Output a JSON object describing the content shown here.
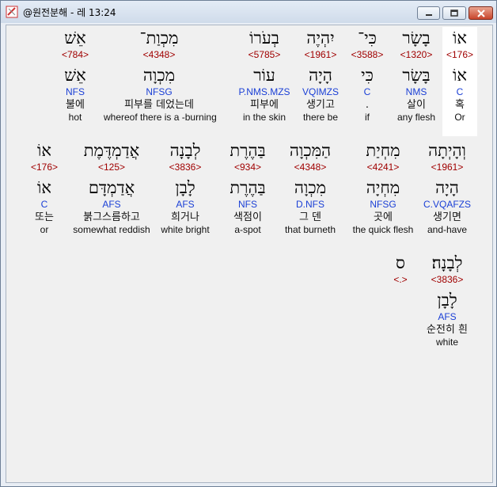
{
  "window": {
    "title": "@원전분해 - 레 13:24",
    "buttons": {
      "minimize": "minimize",
      "maximize": "maximize",
      "close": "close"
    }
  },
  "rows": [
    {
      "words": [
        {
          "heb": "אוֹ",
          "num": "<176>",
          "lemma": "אוֹ",
          "code": "C",
          "kor": "혹",
          "eng": "Or",
          "selected": true
        },
        {
          "heb": "בָשָׂר",
          "num": "<1320>",
          "lemma": "בָּשָׂר",
          "code": "NMS",
          "kor": "살이",
          "eng": "any flesh"
        },
        {
          "heb": "כִּי־",
          "num": "<3588>",
          "lemma": "כִּי",
          "code": "C",
          "kor": ".",
          "eng": "if"
        },
        {
          "heb": "יִהְיֶה",
          "num": "<1961>",
          "lemma": "הָיָה",
          "code": "VQIMZS",
          "kor": "생기고",
          "eng": "there be"
        },
        {
          "heb": "בְעֹרוֹ",
          "num": "<5785>",
          "lemma": "עוֹר",
          "code": "P.NMS.MZS",
          "kor": "피부에",
          "eng": "in the skin"
        },
        {
          "heb": "מִכְוַת־",
          "num": "<4348>",
          "lemma": "מִכְוָה",
          "code": "NFSG",
          "kor": "피부를 데었는데",
          "eng": "whereof there is a -burning"
        },
        {
          "heb": "אֵשׁ",
          "num": "<784>",
          "lemma": "אֵשׁ",
          "code": "NFS",
          "kor": "불에",
          "eng": "hot"
        }
      ]
    },
    {
      "words": [
        {
          "heb": "וְהָיְתָה",
          "num": "<1961>",
          "lemma": "הָיָה",
          "code": "C.VQAFZS",
          "kor": "생기면",
          "eng": "and-have"
        },
        {
          "heb": "מִחְיַת",
          "num": "<4241>",
          "lemma": "מִחְיָה",
          "code": "NFSG",
          "kor": "곳에",
          "eng": "the quick flesh"
        },
        {
          "heb": "הַמִּכְוָה",
          "num": "<4348>",
          "lemma": "מִכְוָה",
          "code": "D.NFS",
          "kor": "그 덴",
          "eng": "that burneth"
        },
        {
          "heb": "בַּהֶרֶת",
          "num": "<934>",
          "lemma": "בַּהֶרֶת",
          "code": "NFS",
          "kor": "색점이",
          "eng": "a-spot"
        },
        {
          "heb": "לְבָנָה",
          "num": "<3836>",
          "lemma": "לָבָן",
          "code": "AFS",
          "kor": "희거나",
          "eng": "white bright"
        },
        {
          "heb": "אֲדַמְדֶּמֶת",
          "num": "<125>",
          "lemma": "אֲדַמְדָּם",
          "code": "AFS",
          "kor": "붉그스름하고",
          "eng": "somewhat reddish"
        },
        {
          "heb": "אוֹ",
          "num": "<176>",
          "lemma": "אוֹ",
          "code": "C",
          "kor": "또는",
          "eng": "or"
        }
      ]
    },
    {
      "words": [
        {
          "heb": "לְבָנָה׃",
          "num": "<3836>",
          "lemma": "לָבָן",
          "code": "AFS",
          "kor": "순전히 흰",
          "eng": "white"
        },
        {
          "heb": "ס",
          "num": "<.>",
          "lemma": "",
          "code": "",
          "kor": "",
          "eng": ""
        }
      ]
    }
  ]
}
